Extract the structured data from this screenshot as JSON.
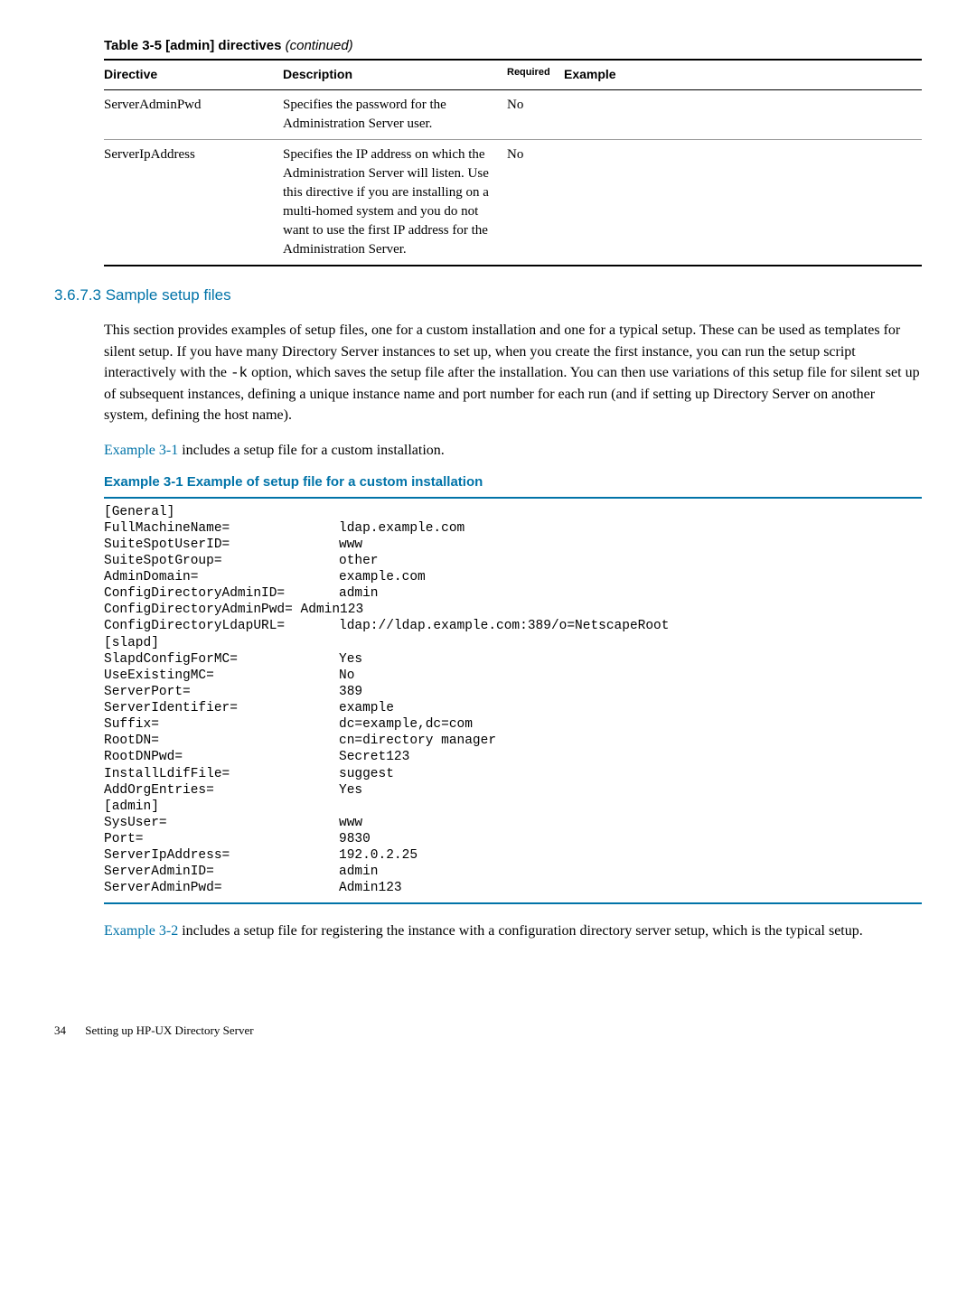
{
  "table": {
    "title_prefix": "Table 3-5 [admin] directives",
    "title_suffix": "(continued)",
    "headers": {
      "directive": "Directive",
      "description": "Description",
      "required": "Required",
      "example": "Example"
    },
    "rows": [
      {
        "directive": "ServerAdminPwd",
        "description": "Specifies the password for the Administration Server user.",
        "required": "No",
        "example": ""
      },
      {
        "directive": "ServerIpAddress",
        "description": "Specifies the IP address on which the Administration Server will listen. Use this directive if you are installing on a multi-homed system and you do not want to use the first IP address for the Administration Server.",
        "required": "No",
        "example": ""
      }
    ]
  },
  "section": {
    "heading": "3.6.7.3 Sample setup files",
    "para1_a": "This section provides examples of setup files, one for a custom installation and one for a typical setup. These can be used as templates for silent setup. If you have many Directory Server instances to set up, when you create the first instance, you can run the setup script interactively with the ",
    "para1_mono": "-k",
    "para1_b": " option, which saves the setup file after the installation. You can then use variations of this setup file for silent set up of subsequent instances, defining a unique instance name and port number for each run (and if setting up Directory Server on another system, defining the host name).",
    "para2_link": "Example 3-1",
    "para2_rest": " includes a setup file for a custom installation."
  },
  "example": {
    "title": "Example 3-1 Example of setup file for a custom installation",
    "lines": [
      {
        "k": "[General]",
        "v": ""
      },
      {
        "k": "FullMachineName=",
        "v": "ldap.example.com"
      },
      {
        "k": "SuiteSpotUserID=",
        "v": "www"
      },
      {
        "k": "SuiteSpotGroup=",
        "v": "other"
      },
      {
        "k": "AdminDomain=",
        "v": "example.com"
      },
      {
        "k": "ConfigDirectoryAdminID=",
        "v": "admin"
      },
      {
        "k": "ConfigDirectoryAdminPwd=",
        "v": "Admin123",
        "nosplit": true
      },
      {
        "k": "ConfigDirectoryLdapURL=",
        "v": "ldap://ldap.example.com:389/o=NetscapeRoot"
      },
      {
        "k": "[slapd]",
        "v": ""
      },
      {
        "k": "SlapdConfigForMC=",
        "v": "Yes"
      },
      {
        "k": "UseExistingMC=",
        "v": "No"
      },
      {
        "k": "ServerPort=",
        "v": "389"
      },
      {
        "k": "ServerIdentifier=",
        "v": "example"
      },
      {
        "k": "Suffix=",
        "v": "dc=example,dc=com"
      },
      {
        "k": "RootDN=",
        "v": "cn=directory manager"
      },
      {
        "k": "RootDNPwd=",
        "v": "Secret123"
      },
      {
        "k": "InstallLdifFile=",
        "v": "suggest"
      },
      {
        "k": "AddOrgEntries=",
        "v": "Yes"
      },
      {
        "k": "[admin]",
        "v": ""
      },
      {
        "k": "SysUser=",
        "v": "www"
      },
      {
        "k": "Port=",
        "v": "9830"
      },
      {
        "k": "ServerIpAddress=",
        "v": "192.0.2.25"
      },
      {
        "k": "ServerAdminID=",
        "v": "admin"
      },
      {
        "k": "ServerAdminPwd=",
        "v": "Admin123"
      }
    ]
  },
  "after": {
    "link": "Example 3-2",
    "rest": " includes a setup file for registering the instance with a configuration directory server setup, which is the typical setup."
  },
  "footer": {
    "page": "34",
    "chapter": "Setting up HP-UX Directory Server"
  }
}
